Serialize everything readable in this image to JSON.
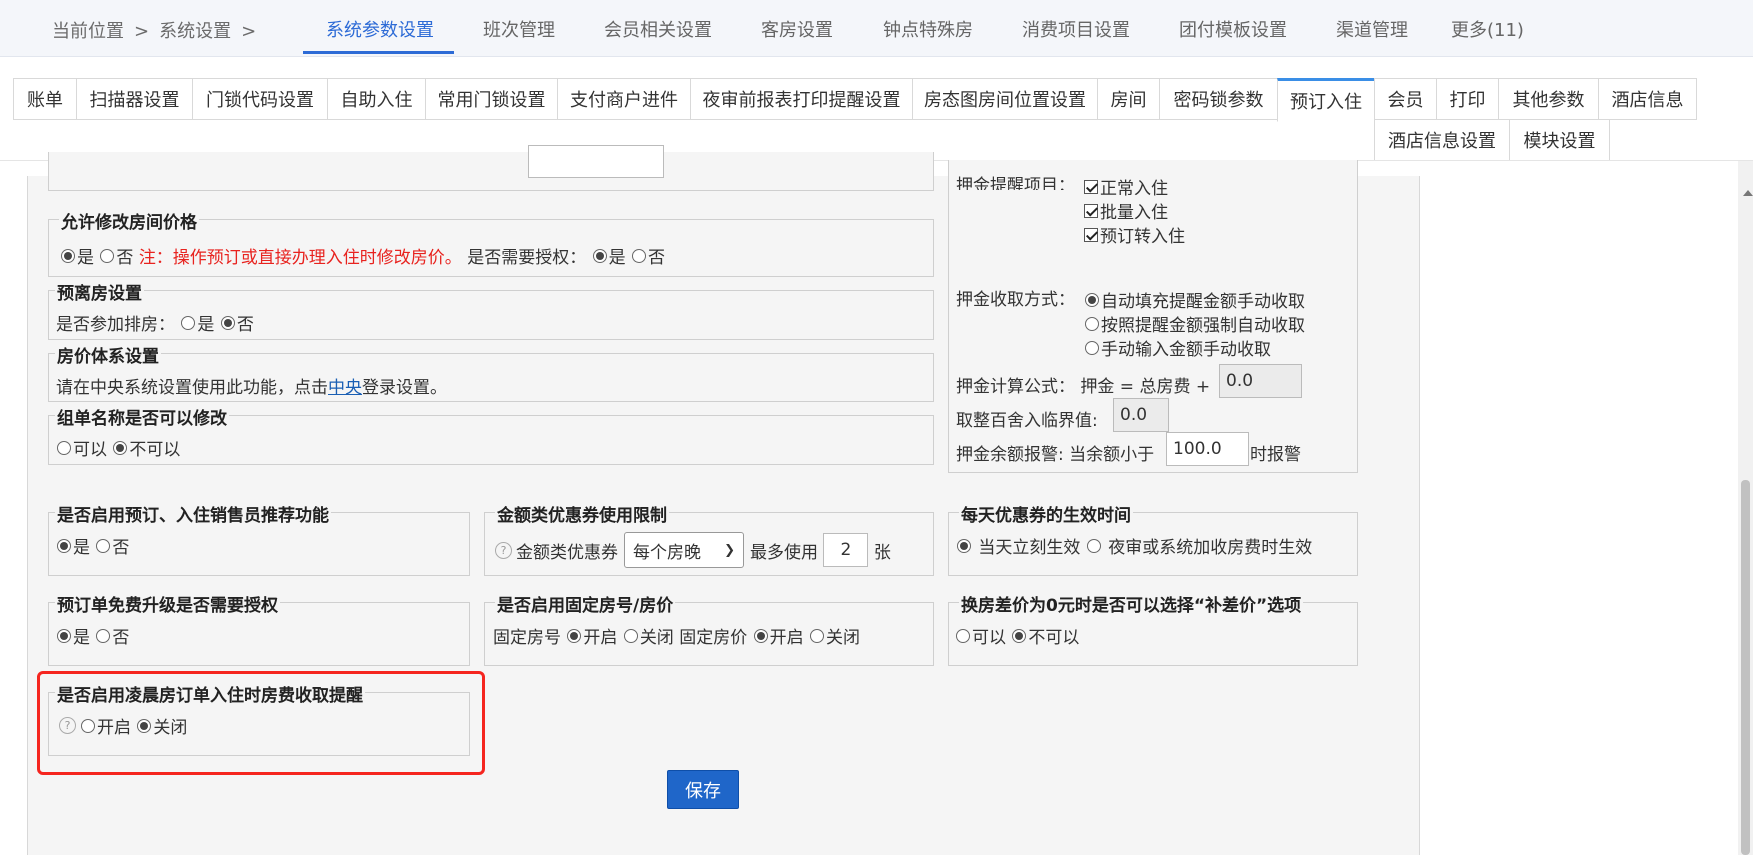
{
  "breadcrumb": {
    "label": "当前位置",
    "sep1": ">",
    "section": "系统设置",
    "sep2": ">"
  },
  "topnav": [
    "系统参数设置",
    "班次管理",
    "会员相关设置",
    "客房设置",
    "钟点特殊房",
    "消费项目设置",
    "团付模板设置",
    "渠道管理",
    "更多(11)"
  ],
  "tabs": [
    "账单",
    "扫描器设置",
    "门锁代码设置",
    "自助入住",
    "常用门锁设置",
    "支付商户进件",
    "夜审前报表打印提醒设置",
    "房态图房间位置设置",
    "房间",
    "密码锁参数",
    "预订入住",
    "会员",
    "打印",
    "其他参数",
    "酒店信息",
    "酒店信息设置",
    "模块设置"
  ],
  "price_edit": {
    "title": "允许修改房间价格",
    "yes": "是",
    "no": "否",
    "note": "注：操作预订或直接办理入住时修改房价。",
    "auth_label": "是否需要授权：",
    "auth_yes": "是",
    "auth_no": "否"
  },
  "pre_checkout": {
    "title": "预离房设置",
    "label": "是否参加排房：",
    "yes": "是",
    "no": "否"
  },
  "price_system": {
    "title": "房价体系设置",
    "text_before": "请在中央系统设置使用此功能，点击",
    "link": "中央",
    "text_after": "登录设置。"
  },
  "group_name": {
    "title": "组单名称是否可以修改",
    "yes": "可以",
    "no": "不可以"
  },
  "deposit": {
    "items_label": "押金提醒项目：",
    "items": [
      "正常入住",
      "批量入住",
      "预订转入住"
    ],
    "method_label": "押金收取方式：",
    "methods": [
      "自动填充提醒金额手动收取",
      "按照提醒金额强制自动收取",
      "手动输入金额手动收取"
    ],
    "formula_label": "押金计算公式：",
    "formula_text": "押金 = 总房费 +",
    "formula_value": "0.0",
    "round_label": "取整百舍入临界值:",
    "round_value": "0.0",
    "alert_label": "押金余额报警:",
    "alert_before": "当余额小于",
    "alert_value": "100.0",
    "alert_after": "时报警"
  },
  "salesman": {
    "title": "是否启用预订、入住销售员推荐功能",
    "yes": "是",
    "no": "否"
  },
  "coupon_limit": {
    "title": "金额类优惠券使用限制",
    "label": "金额类优惠券",
    "select": "每个房晚",
    "max_label": "最多使用",
    "max_value": "2",
    "unit": "张"
  },
  "daily_coupon": {
    "title": "每天优惠券的生效时间",
    "opt1": "当天立刻生效",
    "opt2": "夜审或系统加收房费时生效"
  },
  "upgrade_auth": {
    "title": "预订单免费升级是否需要授权",
    "yes": "是",
    "no": "否"
  },
  "fixed_room": {
    "title": "是否启用固定房号/房价",
    "room_label": "固定房号",
    "price_label": "固定房价",
    "on": "开启",
    "off": "关闭"
  },
  "zero_diff": {
    "title": "换房差价为0元时是否可以选择“补差价”选项",
    "yes": "可以",
    "no": "不可以"
  },
  "early_morning": {
    "title": "是否启用凌晨房订单入住时房费收取提醒",
    "on": "开启",
    "off": "关闭"
  },
  "save_label": "保存"
}
